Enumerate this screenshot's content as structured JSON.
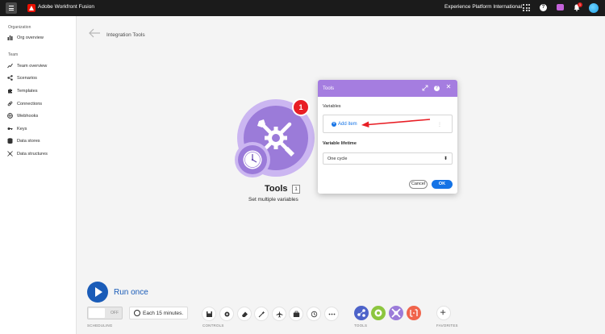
{
  "topbar": {
    "app_title": "Adobe Workfront Fusion",
    "org_name": "Experience Platform International",
    "notification_count": "1"
  },
  "sidebar": {
    "section_org": "Organization",
    "section_team": "Team",
    "org_items": [
      {
        "label": "Org overview",
        "icon": "chart-icon"
      }
    ],
    "team_items": [
      {
        "label": "Team overview",
        "icon": "trend-icon"
      },
      {
        "label": "Scenarios",
        "icon": "share-icon"
      },
      {
        "label": "Templates",
        "icon": "puzzle-icon"
      },
      {
        "label": "Connections",
        "icon": "link-icon"
      },
      {
        "label": "Webhooks",
        "icon": "globe-icon"
      },
      {
        "label": "Keys",
        "icon": "key-icon"
      },
      {
        "label": "Data stores",
        "icon": "database-icon"
      },
      {
        "label": "Data structures",
        "icon": "structure-icon"
      }
    ]
  },
  "page": {
    "title": "Integration Tools"
  },
  "module": {
    "name": "Tools",
    "count": "1",
    "description": "Set multiple variables",
    "badge": "1"
  },
  "dialog": {
    "title": "Tools",
    "variables_label": "Variables",
    "add_item_label": "Add item",
    "lifetime_label": "Variable lifetime",
    "lifetime_value": "One cycle",
    "cancel_label": "Cancel",
    "ok_label": "OK"
  },
  "bottom": {
    "run_label": "Run once",
    "toggle_state": "OFF",
    "schedule_text": "Each 15 minutes.",
    "labels": {
      "scheduling": "SCHEDULING",
      "controls": "CONTROLS",
      "tools": "TOOLS",
      "favorites": "FAVORITES"
    }
  },
  "colors": {
    "topbar": "#1b1b1b",
    "module_purple": "#9b7bd9",
    "dialog_header": "#a57de0",
    "accent_blue": "#1473e6",
    "run_blue": "#1a5cb8",
    "badge_red": "#e81e25"
  }
}
